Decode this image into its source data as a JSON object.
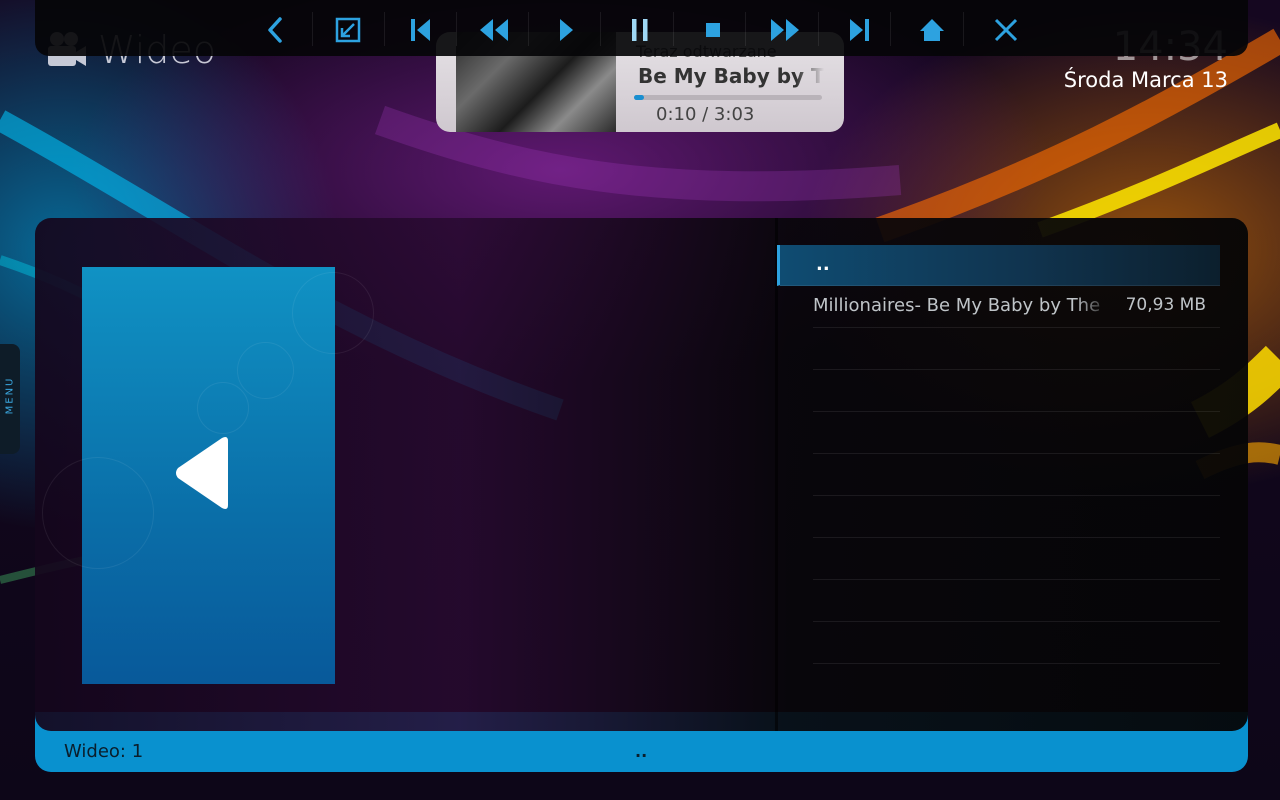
{
  "header": {
    "app_title": "Wideo",
    "app_icon": "video-camera-icon"
  },
  "clock": {
    "time": "14:34",
    "date": "Środa Marca 13"
  },
  "transport": {
    "buttons": [
      {
        "name": "back-icon"
      },
      {
        "name": "fullscreen-icon"
      },
      {
        "name": "skip-previous-icon"
      },
      {
        "name": "rewind-icon"
      },
      {
        "name": "play-icon"
      },
      {
        "name": "pause-icon"
      },
      {
        "name": "stop-icon"
      },
      {
        "name": "fast-forward-icon"
      },
      {
        "name": "skip-next-icon"
      },
      {
        "name": "home-icon"
      },
      {
        "name": "close-icon"
      }
    ],
    "active_color": "#2da2e0"
  },
  "now_playing": {
    "label": "Teraz odtwarzane",
    "title": "Be My Baby by The",
    "time": "0:10 / 3:03",
    "progress": 0.055
  },
  "side_menu": {
    "label": "MENU"
  },
  "file_list": {
    "parent_label": "..",
    "items": [
      {
        "name": "Millionaires- Be My Baby by The",
        "size": "70,93 MB"
      }
    ]
  },
  "footer": {
    "count_text": "Wideo: 1",
    "path_text": ".."
  },
  "colors": {
    "accent": "#0991cf",
    "thumb_blue": "#1092c4"
  }
}
